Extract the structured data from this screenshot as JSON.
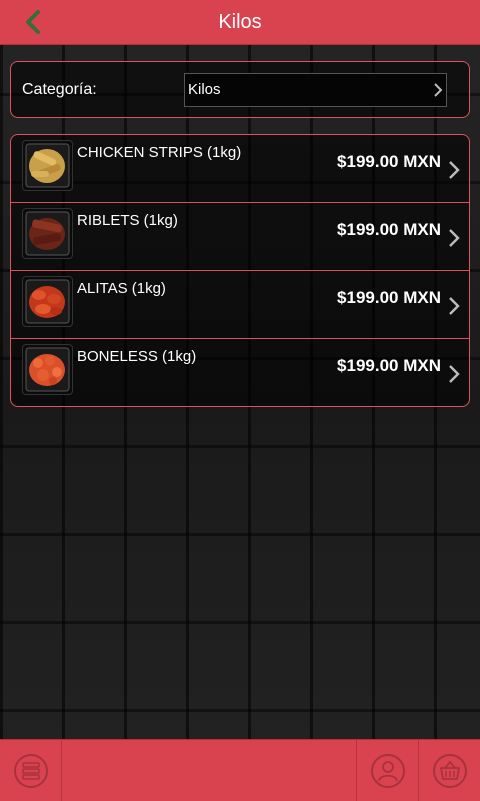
{
  "header": {
    "title": "Kilos"
  },
  "category": {
    "label": "Categoría:",
    "selected": "Kilos"
  },
  "products": [
    {
      "name": "CHICKEN STRIPS (1kg)",
      "price": "$199.00 MXN"
    },
    {
      "name": "RIBLETS (1kg)",
      "price": "$199.00 MXN"
    },
    {
      "name": "ALITAS (1kg)",
      "price": "$199.00 MXN"
    },
    {
      "name": "BONELESS (1kg)",
      "price": "$199.00 MXN"
    }
  ],
  "colors": {
    "accent": "#d9434f",
    "back_icon": "#3a6b3a"
  },
  "icons": {
    "back": "chevron-left-icon",
    "menu": "stack-icon",
    "profile": "user-icon",
    "cart": "basket-icon"
  }
}
